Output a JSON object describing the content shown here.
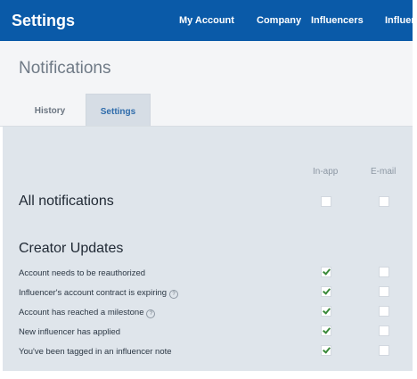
{
  "app": {
    "title": "Settings"
  },
  "nav": {
    "items": [
      "My Account",
      "Company",
      "Influencers",
      "Influencer List"
    ]
  },
  "page": {
    "title": "Notifications"
  },
  "tabs": {
    "history": "History",
    "settings": "Settings",
    "active": "Settings"
  },
  "columns": {
    "in_app": "In-app",
    "email": "E-mail"
  },
  "all_notifications": {
    "label": "All notifications",
    "in_app": false,
    "email": false
  },
  "creator_updates": {
    "title": "Creator Updates",
    "rows": [
      {
        "label": "Account needs to be reauthorized",
        "help": false,
        "in_app": true,
        "email": false
      },
      {
        "label": "Influencer's account contract is expiring",
        "help": true,
        "in_app": true,
        "email": false
      },
      {
        "label": "Account has reached a milestone",
        "help": true,
        "in_app": true,
        "email": false
      },
      {
        "label": "New influencer has applied",
        "help": false,
        "in_app": true,
        "email": false
      },
      {
        "label": "You've been tagged in an influencer note",
        "help": false,
        "in_app": true,
        "email": false
      }
    ]
  },
  "colors": {
    "topbar": "#0a5aa8",
    "panel": "#dfe5eb",
    "check": "#3a8a3a",
    "active_tab_text": "#2f6cab"
  }
}
